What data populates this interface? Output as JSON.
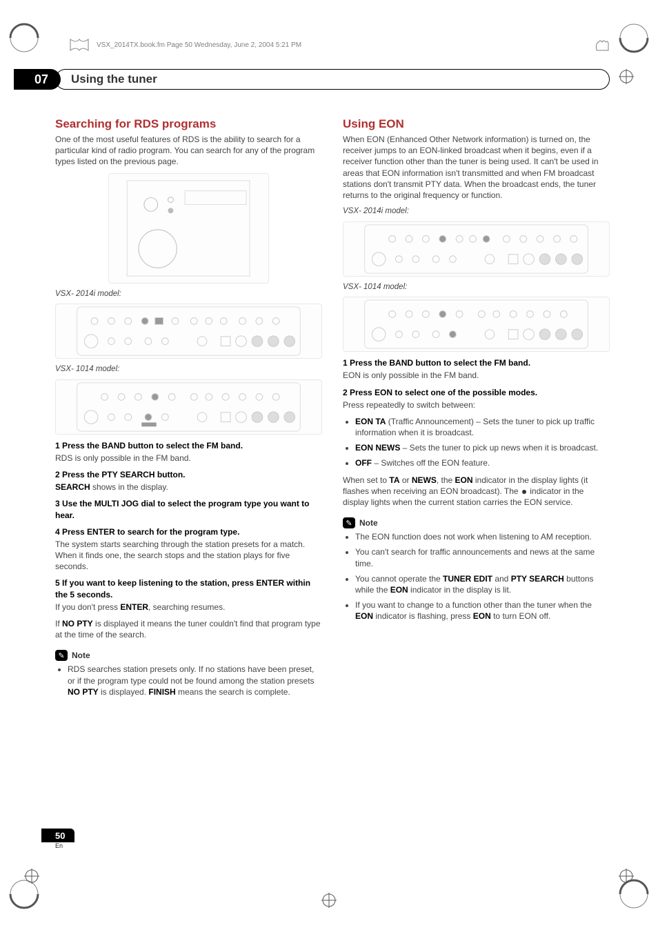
{
  "bookHeader": "VSX_2014TX.book.fm  Page 50  Wednesday, June 2, 2004  5:21 PM",
  "chapterNumber": "07",
  "sectionTitle": "Using the tuner",
  "model1Caption": "VSX- 2014i model:",
  "model2Caption": "VSX- 1014 model:",
  "leftCol": {
    "h2": "Searching for RDS programs",
    "intro": "One of the most useful features of RDS is the ability to search for a particular kind of radio program. You can search for any of the program types listed on the previous page.",
    "steps": {
      "s1_title": "1   Press the BAND button to select the FM band.",
      "s1_desc": "RDS is only possible in the FM band.",
      "s2_title": "2   Press the PTY SEARCH button.",
      "s2_desc_pre": "SEARCH",
      "s2_desc_post": " shows in the display.",
      "s3_title": "3   Use the MULTI JOG dial to select the program type you want to hear.",
      "s4_title": "4   Press ENTER to search for the program type.",
      "s4_desc": "The system starts searching through the station presets for a match. When it finds one, the search stops and the station plays for five seconds.",
      "s5_title": "5   If you want to keep listening to the station, press ENTER within the 5 seconds.",
      "s5_desc_a_pre": "If you don't press ",
      "s5_desc_a_bold": "ENTER",
      "s5_desc_a_post": ", searching resumes.",
      "s5_desc_b_pre": "If ",
      "s5_desc_b_bold": "NO PTY",
      "s5_desc_b_post": " is displayed it means the tuner couldn't find that program type at the time of the search."
    },
    "noteLabel": "Note",
    "noteBullets": {
      "b1_pre": "RDS searches station presets only. If no stations have been preset, or if the program type could not be found among the station presets ",
      "b1_bold1": "NO PTY",
      "b1_mid": " is displayed. ",
      "b1_bold2": "FINISH",
      "b1_post": " means the search is complete."
    }
  },
  "rightCol": {
    "h2": "Using EON",
    "intro": "When EON (Enhanced Other Network information) is turned on, the receiver jumps to an EON-linked broadcast when it begins, even if a receiver function other than the tuner is being used. It can't be used in areas that EON information isn't transmitted and when FM broadcast stations don't transmit PTY data. When the broadcast ends, the tuner returns to the original frequency or function.",
    "steps": {
      "s1_title": "1   Press the BAND button to select the FM band.",
      "s1_desc": "EON is only possible in the FM band.",
      "s2_title": "2   Press EON to select one of the possible modes.",
      "s2_desc": "Press repeatedly to switch between:"
    },
    "options": {
      "o1_bold": "EON TA",
      "o1_rest": " (Traffic Announcement) – Sets the tuner to pick up traffic information when it is broadcast.",
      "o2_bold": "EON NEWS",
      "o2_rest": " – Sets the tuner to pick up news when it is broadcast.",
      "o3_bold": "OFF",
      "o3_rest": " – Switches off the EON feature."
    },
    "afterOptions": {
      "p1_a": "When set to ",
      "p1_b1": "TA",
      "p1_b": " or ",
      "p1_b2": "NEWS",
      "p1_c": ", the ",
      "p1_b3": "EON",
      "p1_d": " indicator in the display lights (it flashes when receiving an EON broadcast). The ",
      "p1_e": " indicator in the display lights when the current station carries the EON service."
    },
    "noteLabel": "Note",
    "noteBullets": {
      "b1": "The EON function does not work when listening to AM reception.",
      "b2": "You can't search for traffic announcements and news at the same time.",
      "b3_a": "You cannot operate the ",
      "b3_b1": "TUNER EDIT",
      "b3_b": " and ",
      "b3_b2": "PTY SEARCH",
      "b3_c": " buttons while the ",
      "b3_b3": "EON",
      "b3_d": " indicator in the display is lit.",
      "b4_a": "If you want to change to a function other than the tuner when the ",
      "b4_b1": "EON",
      "b4_b": " indicator is flashing, press ",
      "b4_b2": "EON",
      "b4_c": " to turn EON off."
    }
  },
  "pageNumber": "50",
  "pageLang": "En"
}
